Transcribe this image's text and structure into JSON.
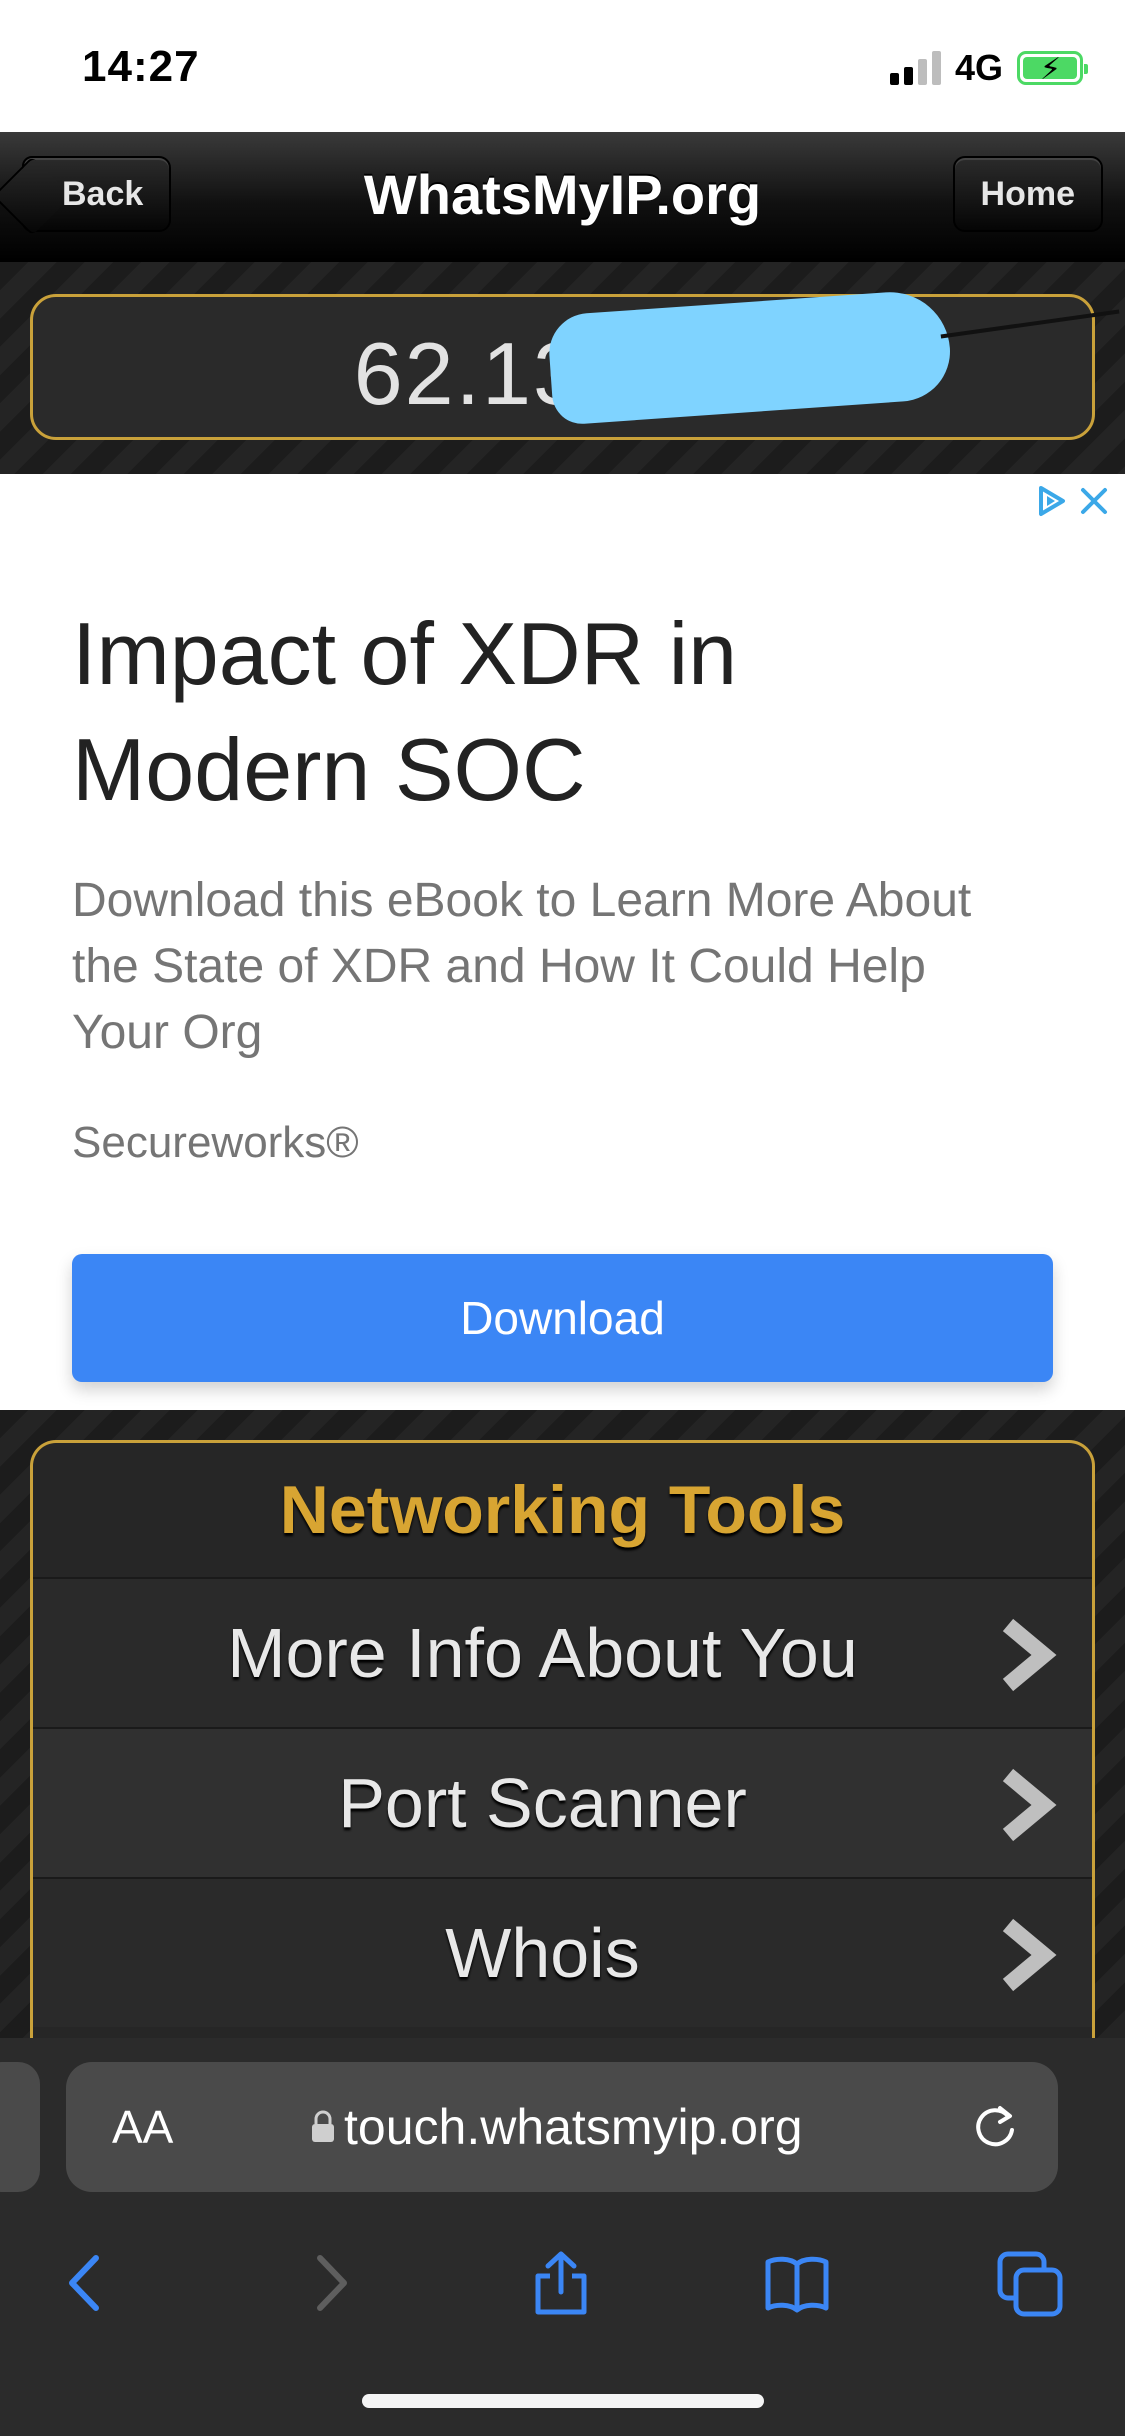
{
  "status_bar": {
    "time": "14:27",
    "network": "4G"
  },
  "nav": {
    "back_label": "Back",
    "title": "WhatsMyIP.org",
    "home_label": "Home"
  },
  "ip": {
    "visible_prefix": "62.133."
  },
  "ad": {
    "title": "Impact of XDR in Modern SOC",
    "description": "Download this eBook to Learn More About the State of XDR and How It Could Help Your Org",
    "brand": "Secureworks®",
    "cta": "Download"
  },
  "tools": {
    "title": "Networking Tools",
    "items": [
      {
        "label": "More Info About You"
      },
      {
        "label": "Port Scanner"
      },
      {
        "label": "Whois"
      }
    ]
  },
  "safari": {
    "aa": "AA",
    "url": "touch.whatsmyip.org"
  },
  "colors": {
    "accent_gold": "#d8a532",
    "ad_button": "#3b86f5",
    "link_blue": "#3b86f5"
  }
}
